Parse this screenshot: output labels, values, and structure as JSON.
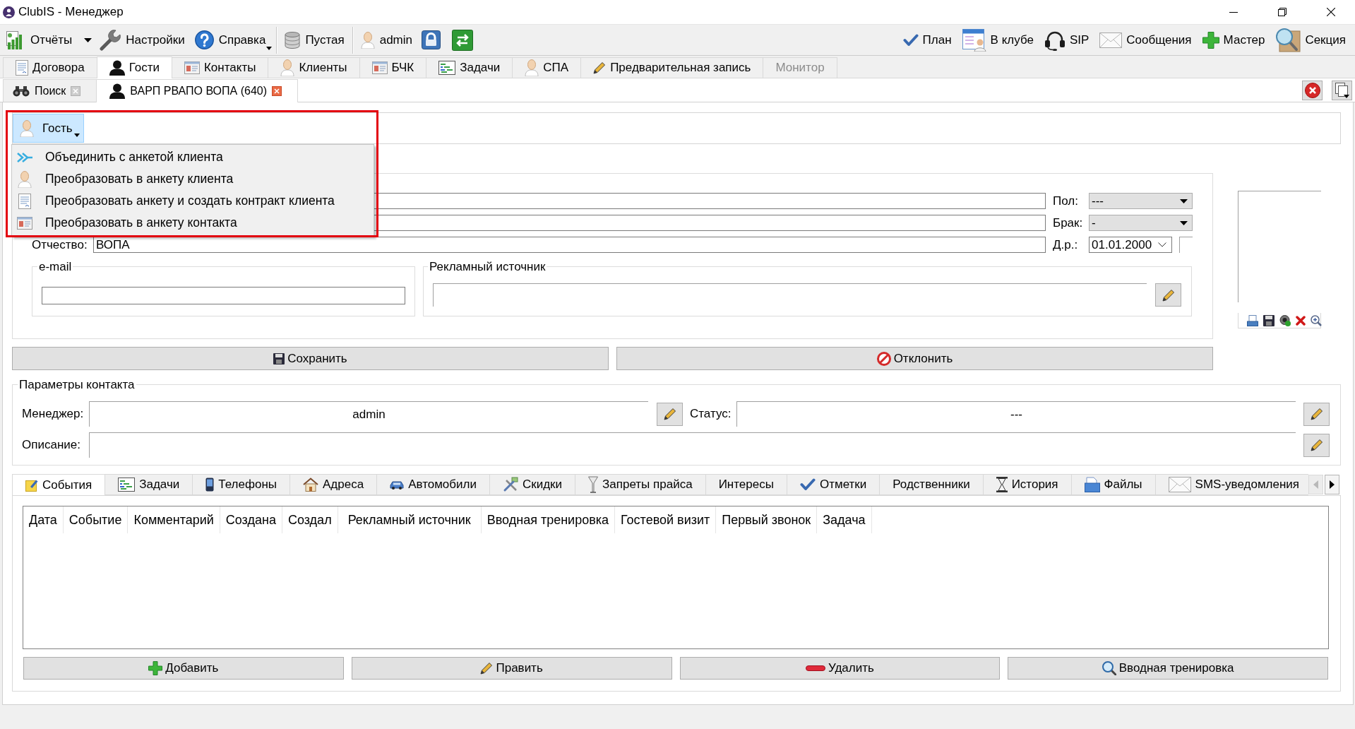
{
  "window": {
    "title": "ClubIS - Менеджер"
  },
  "toolbar": {
    "left": [
      {
        "label": "Отчёты",
        "kind": "split"
      },
      {
        "label": "Настройки",
        "kind": "plain"
      },
      {
        "label": "Справка",
        "kind": "menu"
      },
      {
        "label": "Пустая",
        "kind": "database"
      },
      {
        "label": "admin",
        "kind": "user"
      }
    ],
    "right": [
      "План",
      "В клубе",
      "SIP",
      "Сообщения",
      "Мастер",
      "Секция"
    ]
  },
  "main_tabs": [
    {
      "label": "Договора",
      "selected": false,
      "disabled": false
    },
    {
      "label": "Гости",
      "selected": true,
      "disabled": false
    },
    {
      "label": "Контакты",
      "selected": false,
      "disabled": false
    },
    {
      "label": "Клиенты",
      "selected": false,
      "disabled": false
    },
    {
      "label": "БЧК",
      "selected": false,
      "disabled": false
    },
    {
      "label": "Задачи",
      "selected": false,
      "disabled": false
    },
    {
      "label": "СПА",
      "selected": false,
      "disabled": false
    },
    {
      "label": "Предварительная запись",
      "selected": false,
      "disabled": false
    },
    {
      "label": "Монитор",
      "selected": false,
      "disabled": true
    }
  ],
  "document_tabs": [
    {
      "label": "Поиск",
      "selected": false
    },
    {
      "label": "ВАРП РВАПО ВОПА (640)",
      "selected": true
    }
  ],
  "guest_button": {
    "label": "Гость",
    "expanded": true
  },
  "guest_menu": [
    "Объединить с анкетой клиента",
    "Преобразовать в анкету клиента",
    "Преобразовать анкету и создать контракт клиента",
    "Преобразовать в анкету контакта"
  ],
  "person_form": {
    "rows": [
      {
        "kind": "select",
        "side_label": "Пол:",
        "side_value": "---"
      },
      {
        "kind": "select",
        "side_label": "Брак:",
        "side_value": "-"
      },
      {
        "kind": "date",
        "label": "Отчество:",
        "value": "ВОПА",
        "side_label": "Д.р.:",
        "side_value": "01.01.2000"
      }
    ],
    "email_title": "e-mail",
    "ad_source_title": "Рекламный источник"
  },
  "form_buttons": [
    "Сохранить",
    "Отклонить"
  ],
  "contact_params": {
    "title": "Параметры контакта",
    "manager_label": "Менеджер:",
    "manager_value": "admin",
    "status_label": "Статус:",
    "status_value": "---",
    "description_label": "Описание:"
  },
  "detail_tabs": [
    {
      "label": "События",
      "selected": true
    },
    {
      "label": "Задачи",
      "selected": false
    },
    {
      "label": "Телефоны",
      "selected": false
    },
    {
      "label": "Адреса",
      "selected": false
    },
    {
      "label": "Автомобили",
      "selected": false
    },
    {
      "label": "Скидки",
      "selected": false
    },
    {
      "label": "Запреты прайса",
      "selected": false
    },
    {
      "label": "Интересы",
      "selected": false
    },
    {
      "label": "Отметки",
      "selected": false
    },
    {
      "label": "Родственники",
      "selected": false
    },
    {
      "label": "История",
      "selected": false
    },
    {
      "label": "Файлы",
      "selected": false
    },
    {
      "label": "SMS-уведомления",
      "selected": false
    }
  ],
  "detail_tabs_scroll": {
    "back_disabled": true,
    "forward_disabled": false
  },
  "events_table": {
    "columns": [
      "Дата",
      "Событие",
      "Комментарий",
      "Создана",
      "Создал",
      "Рекламный источник",
      "Вводная тренировка",
      "Гостевой визит",
      "Первый звонок",
      "Задача"
    ]
  },
  "table_buttons": [
    "Добавить",
    "Править",
    "Удалить",
    "Вводная тренировка"
  ]
}
